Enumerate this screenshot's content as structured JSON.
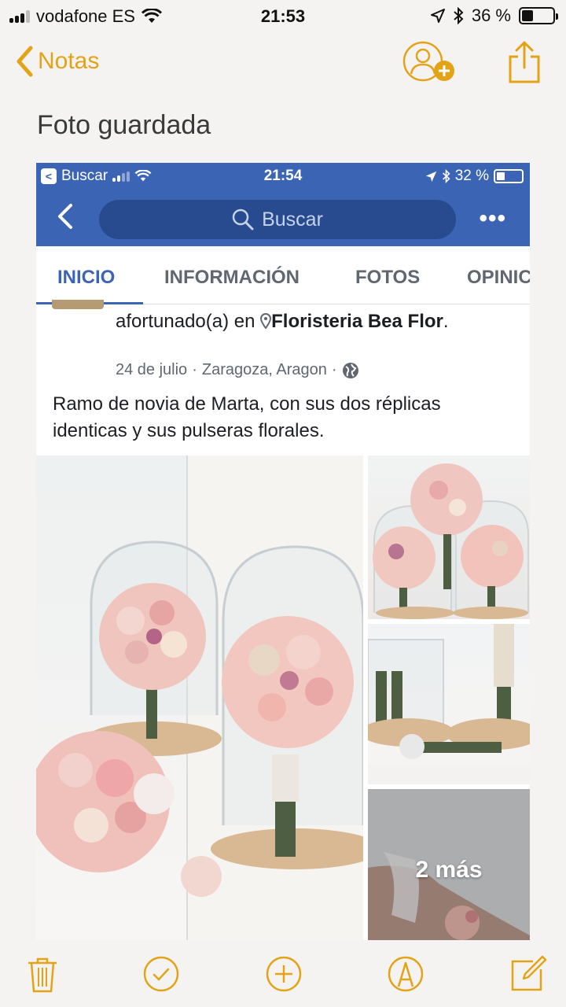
{
  "status_bar": {
    "carrier": "vodafone ES",
    "time": "21:53",
    "battery": "36 %",
    "battery_level": 0.36
  },
  "notes_nav": {
    "back_label": "Notas"
  },
  "note": {
    "title": "Foto guardada"
  },
  "screenshot": {
    "status": {
      "back_app": "Buscar",
      "time": "21:54",
      "battery": "32 %",
      "battery_level": 0.32
    },
    "search_placeholder": "Buscar",
    "tabs": [
      "INICIO",
      "INFORMACIÓN",
      "FOTOS",
      "OPINIC"
    ],
    "post": {
      "head_prefix": "afortunado(a) en",
      "place": "Floristeria Bea Flor",
      "place_suffix": ".",
      "date": "24 de julio",
      "location": "Zaragoza, Aragon",
      "caption": "Ramo de novia de Marta, con sus dos réplicas identicas y sus pulseras florales."
    },
    "more_photos_label": "2 más"
  },
  "colors": {
    "notes_accent": "#e3a317",
    "facebook_blue": "#3b64b4"
  },
  "icons": [
    "chevron-left-icon",
    "add-person-icon",
    "share-icon",
    "search-icon",
    "more-icon",
    "pin-icon",
    "globe-icon",
    "trash-icon",
    "checkmark-icon",
    "plus-icon",
    "pen-icon",
    "compose-icon"
  ]
}
